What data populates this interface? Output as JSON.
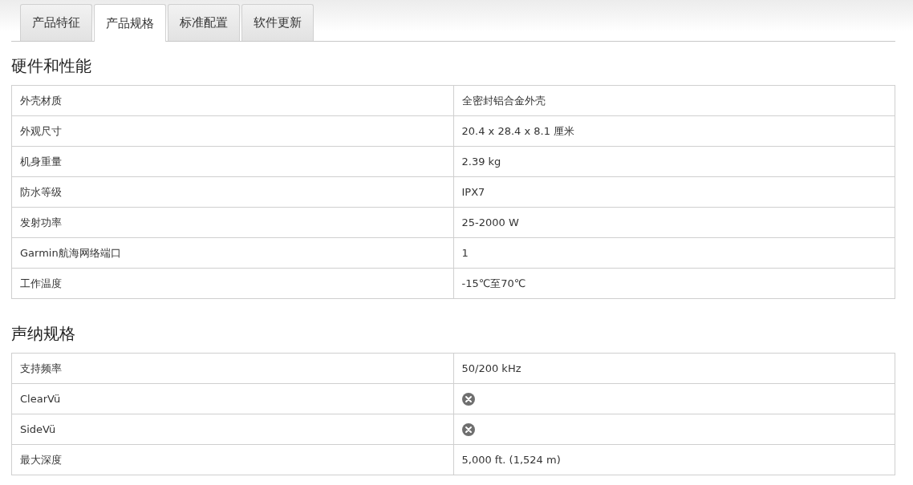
{
  "tabs": [
    {
      "label": "产品特征",
      "selected": false
    },
    {
      "label": "产品规格",
      "selected": true
    },
    {
      "label": "标准配置",
      "selected": false
    },
    {
      "label": "软件更新",
      "selected": false
    }
  ],
  "sections": [
    {
      "title": "硬件和性能",
      "rows": [
        {
          "label": "外壳材质",
          "kind": "text",
          "value": "全密封铝合金外壳"
        },
        {
          "label": "外观尺寸",
          "kind": "text",
          "value": "20.4 x 28.4 x 8.1 厘米"
        },
        {
          "label": "机身重量",
          "kind": "text",
          "value": "2.39 kg"
        },
        {
          "label": "防水等级",
          "kind": "text",
          "value": "IPX7"
        },
        {
          "label": "发射功率",
          "kind": "text",
          "value": "25-2000 W"
        },
        {
          "label": "Garmin航海网络端口",
          "kind": "text",
          "value": "1"
        },
        {
          "label": "工作温度",
          "kind": "text",
          "value": "-15℃至70℃"
        }
      ]
    },
    {
      "title": "声纳规格",
      "rows": [
        {
          "label": "支持频率",
          "kind": "text",
          "value": "50/200 kHz"
        },
        {
          "label": "ClearVü",
          "kind": "unsupported"
        },
        {
          "label": "SideVü",
          "kind": "unsupported"
        },
        {
          "label": "最大深度",
          "kind": "text",
          "value": "5,000 ft. (1,524 m)"
        }
      ]
    }
  ]
}
